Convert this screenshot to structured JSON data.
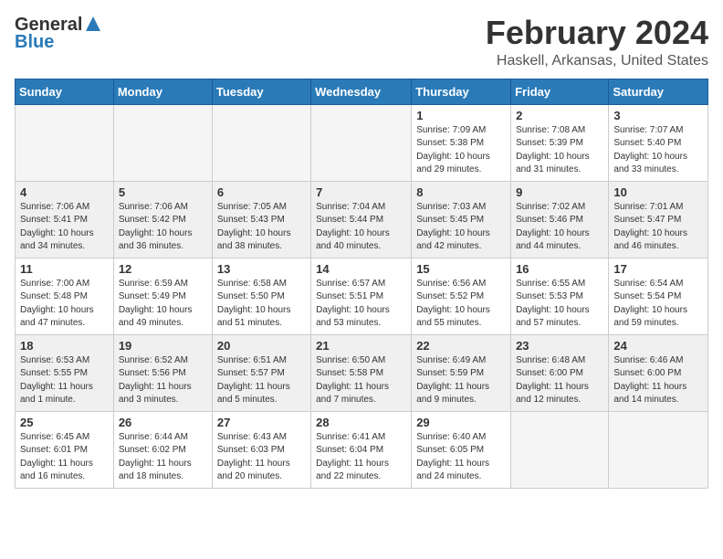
{
  "header": {
    "logo_general": "General",
    "logo_blue": "Blue",
    "month": "February 2024",
    "location": "Haskell, Arkansas, United States"
  },
  "weekdays": [
    "Sunday",
    "Monday",
    "Tuesday",
    "Wednesday",
    "Thursday",
    "Friday",
    "Saturday"
  ],
  "weeks": [
    [
      {
        "day": "",
        "info": ""
      },
      {
        "day": "",
        "info": ""
      },
      {
        "day": "",
        "info": ""
      },
      {
        "day": "",
        "info": ""
      },
      {
        "day": "1",
        "info": "Sunrise: 7:09 AM\nSunset: 5:38 PM\nDaylight: 10 hours\nand 29 minutes."
      },
      {
        "day": "2",
        "info": "Sunrise: 7:08 AM\nSunset: 5:39 PM\nDaylight: 10 hours\nand 31 minutes."
      },
      {
        "day": "3",
        "info": "Sunrise: 7:07 AM\nSunset: 5:40 PM\nDaylight: 10 hours\nand 33 minutes."
      }
    ],
    [
      {
        "day": "4",
        "info": "Sunrise: 7:06 AM\nSunset: 5:41 PM\nDaylight: 10 hours\nand 34 minutes."
      },
      {
        "day": "5",
        "info": "Sunrise: 7:06 AM\nSunset: 5:42 PM\nDaylight: 10 hours\nand 36 minutes."
      },
      {
        "day": "6",
        "info": "Sunrise: 7:05 AM\nSunset: 5:43 PM\nDaylight: 10 hours\nand 38 minutes."
      },
      {
        "day": "7",
        "info": "Sunrise: 7:04 AM\nSunset: 5:44 PM\nDaylight: 10 hours\nand 40 minutes."
      },
      {
        "day": "8",
        "info": "Sunrise: 7:03 AM\nSunset: 5:45 PM\nDaylight: 10 hours\nand 42 minutes."
      },
      {
        "day": "9",
        "info": "Sunrise: 7:02 AM\nSunset: 5:46 PM\nDaylight: 10 hours\nand 44 minutes."
      },
      {
        "day": "10",
        "info": "Sunrise: 7:01 AM\nSunset: 5:47 PM\nDaylight: 10 hours\nand 46 minutes."
      }
    ],
    [
      {
        "day": "11",
        "info": "Sunrise: 7:00 AM\nSunset: 5:48 PM\nDaylight: 10 hours\nand 47 minutes."
      },
      {
        "day": "12",
        "info": "Sunrise: 6:59 AM\nSunset: 5:49 PM\nDaylight: 10 hours\nand 49 minutes."
      },
      {
        "day": "13",
        "info": "Sunrise: 6:58 AM\nSunset: 5:50 PM\nDaylight: 10 hours\nand 51 minutes."
      },
      {
        "day": "14",
        "info": "Sunrise: 6:57 AM\nSunset: 5:51 PM\nDaylight: 10 hours\nand 53 minutes."
      },
      {
        "day": "15",
        "info": "Sunrise: 6:56 AM\nSunset: 5:52 PM\nDaylight: 10 hours\nand 55 minutes."
      },
      {
        "day": "16",
        "info": "Sunrise: 6:55 AM\nSunset: 5:53 PM\nDaylight: 10 hours\nand 57 minutes."
      },
      {
        "day": "17",
        "info": "Sunrise: 6:54 AM\nSunset: 5:54 PM\nDaylight: 10 hours\nand 59 minutes."
      }
    ],
    [
      {
        "day": "18",
        "info": "Sunrise: 6:53 AM\nSunset: 5:55 PM\nDaylight: 11 hours\nand 1 minute."
      },
      {
        "day": "19",
        "info": "Sunrise: 6:52 AM\nSunset: 5:56 PM\nDaylight: 11 hours\nand 3 minutes."
      },
      {
        "day": "20",
        "info": "Sunrise: 6:51 AM\nSunset: 5:57 PM\nDaylight: 11 hours\nand 5 minutes."
      },
      {
        "day": "21",
        "info": "Sunrise: 6:50 AM\nSunset: 5:58 PM\nDaylight: 11 hours\nand 7 minutes."
      },
      {
        "day": "22",
        "info": "Sunrise: 6:49 AM\nSunset: 5:59 PM\nDaylight: 11 hours\nand 9 minutes."
      },
      {
        "day": "23",
        "info": "Sunrise: 6:48 AM\nSunset: 6:00 PM\nDaylight: 11 hours\nand 12 minutes."
      },
      {
        "day": "24",
        "info": "Sunrise: 6:46 AM\nSunset: 6:00 PM\nDaylight: 11 hours\nand 14 minutes."
      }
    ],
    [
      {
        "day": "25",
        "info": "Sunrise: 6:45 AM\nSunset: 6:01 PM\nDaylight: 11 hours\nand 16 minutes."
      },
      {
        "day": "26",
        "info": "Sunrise: 6:44 AM\nSunset: 6:02 PM\nDaylight: 11 hours\nand 18 minutes."
      },
      {
        "day": "27",
        "info": "Sunrise: 6:43 AM\nSunset: 6:03 PM\nDaylight: 11 hours\nand 20 minutes."
      },
      {
        "day": "28",
        "info": "Sunrise: 6:41 AM\nSunset: 6:04 PM\nDaylight: 11 hours\nand 22 minutes."
      },
      {
        "day": "29",
        "info": "Sunrise: 6:40 AM\nSunset: 6:05 PM\nDaylight: 11 hours\nand 24 minutes."
      },
      {
        "day": "",
        "info": ""
      },
      {
        "day": "",
        "info": ""
      }
    ]
  ]
}
